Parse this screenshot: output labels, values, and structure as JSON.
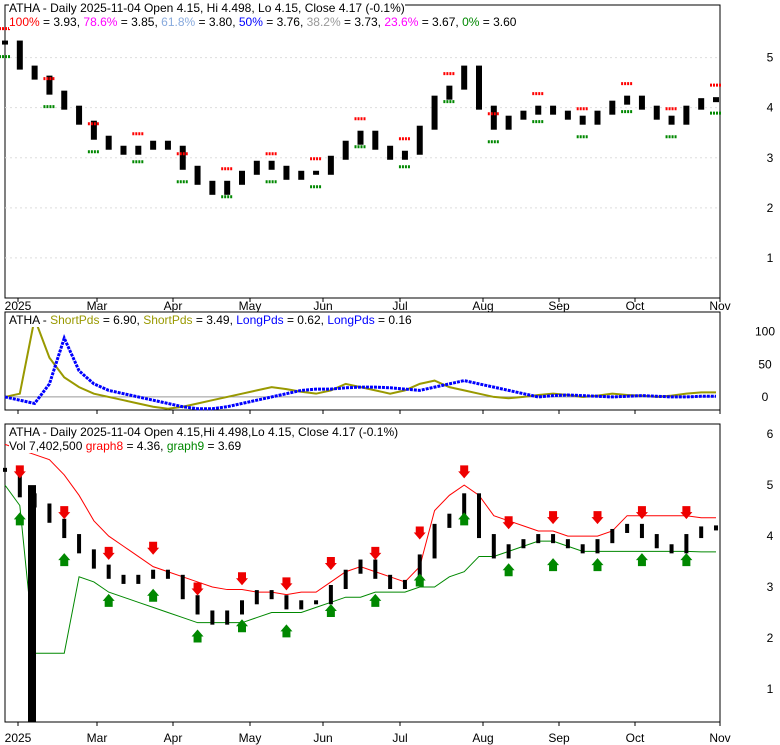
{
  "chart_data": [
    {
      "type": "line",
      "title": "ATHA - Daily 2025-11-04 Open 4.15, Hi 4.498, Lo 4.15, Close 4.17 (-0.1%)",
      "fib": [
        {
          "label": "100%",
          "value": "3.93",
          "color": "#ff0000"
        },
        {
          "label": "78.6%",
          "value": "3.85",
          "color": "#ff00ff"
        },
        {
          "label": "61.8%",
          "value": "3.80",
          "color": "#88aadd"
        },
        {
          "label": "50%",
          "value": "3.76",
          "color": "#0000ff"
        },
        {
          "label": "38.2%",
          "value": "3.73",
          "color": "#999999"
        },
        {
          "label": "23.6%",
          "value": "3.67",
          "color": "#ff00ff"
        },
        {
          "label": "0%",
          "value": "3.60",
          "color": "#008800"
        }
      ],
      "ylim": [
        0.5,
        6.5
      ],
      "yticks": [
        1,
        2,
        3,
        4,
        5
      ],
      "xticks": [
        "2025",
        "Mar",
        "Apr",
        "May",
        "Jun",
        "Jul",
        "Aug",
        "Sep",
        "Oct",
        "Nov"
      ],
      "close": [
        5.3,
        4.8,
        4.6,
        4.3,
        4.0,
        3.7,
        3.4,
        3.2,
        3.1,
        3.2,
        3.3,
        3.2,
        2.8,
        2.5,
        2.3,
        2.5,
        2.7,
        2.9,
        2.8,
        2.6,
        2.7,
        2.7,
        3.0,
        3.3,
        3.5,
        3.2,
        3.0,
        3.1,
        3.6,
        4.2,
        4.4,
        4.8,
        4.0,
        3.6,
        3.8,
        3.9,
        4.0,
        3.9,
        3.8,
        3.7,
        3.9,
        4.1,
        4.2,
        4.0,
        3.8,
        3.7,
        4.0,
        4.15,
        4.17
      ]
    },
    {
      "type": "line",
      "title": "ATHA - ShortPds = 6.90, ShortPds = 3.49, LongPds = 0.62, LongPds = 0.16",
      "legend": [
        {
          "name": "ShortPds",
          "value": "6.90",
          "color": "#999900"
        },
        {
          "name": "ShortPds",
          "value": "3.49",
          "color": "#999900"
        },
        {
          "name": "LongPds",
          "value": "0.62",
          "color": "#0000ff"
        },
        {
          "name": "LongPds",
          "value": "0.16",
          "color": "#0000ff"
        }
      ],
      "yticks": [
        100,
        50,
        0
      ],
      "ylim": [
        -20,
        130
      ],
      "series": [
        {
          "name": "ShortPds",
          "color": "#999900",
          "values": [
            0,
            5,
            120,
            60,
            30,
            15,
            5,
            0,
            -5,
            -10,
            -15,
            -18,
            -15,
            -10,
            -5,
            0,
            5,
            10,
            15,
            12,
            8,
            5,
            10,
            20,
            15,
            10,
            5,
            10,
            20,
            25,
            15,
            10,
            5,
            0,
            -2,
            0,
            3,
            5,
            3,
            0,
            2,
            5,
            3,
            2,
            0,
            2,
            5,
            7,
            7
          ]
        },
        {
          "name": "LongPds",
          "color": "#0000ff",
          "values": [
            0,
            -5,
            -10,
            20,
            90,
            40,
            20,
            10,
            5,
            0,
            -5,
            -10,
            -15,
            -18,
            -18,
            -15,
            -10,
            -5,
            0,
            5,
            10,
            12,
            12,
            14,
            15,
            15,
            14,
            12,
            10,
            15,
            20,
            25,
            20,
            15,
            10,
            5,
            0,
            2,
            3,
            2,
            1,
            0,
            1,
            2,
            1,
            0,
            0,
            1,
            1
          ]
        }
      ]
    },
    {
      "type": "line",
      "title": "ATHA - Daily 2025-11-04 Open 4.15,Hi 4.498,Lo 4.15, Close 4.17 (-0.1%)",
      "legend": [
        {
          "name": "Vol",
          "value": "7,402,500",
          "color": "#000000"
        },
        {
          "name": "graph8",
          "value": "4.36",
          "color": "#ff0000"
        },
        {
          "name": "graph9",
          "value": "3.69",
          "color": "#008800"
        }
      ],
      "ylim": [
        0.5,
        6.5
      ],
      "yticks": [
        1,
        2,
        3,
        4,
        5,
        6
      ],
      "graph8": [
        5.8,
        5.7,
        5.6,
        5.5,
        5.2,
        4.8,
        4.3,
        4.0,
        3.8,
        3.6,
        3.4,
        3.3,
        3.2,
        3.1,
        3.0,
        2.95,
        2.95,
        2.9,
        2.9,
        2.85,
        2.9,
        2.9,
        3.1,
        3.3,
        3.4,
        3.3,
        3.2,
        3.1,
        3.4,
        4.5,
        4.8,
        5.0,
        4.8,
        4.4,
        4.3,
        4.2,
        4.1,
        4.1,
        4.0,
        4.0,
        4.0,
        4.1,
        4.4,
        4.4,
        4.4,
        4.4,
        4.4,
        4.36,
        4.36
      ],
      "graph9": [
        5.0,
        4.6,
        1.7,
        1.7,
        1.7,
        3.2,
        3.1,
        2.9,
        2.8,
        2.7,
        2.6,
        2.5,
        2.4,
        2.3,
        2.3,
        2.3,
        2.3,
        2.4,
        2.5,
        2.5,
        2.5,
        2.6,
        2.7,
        2.8,
        2.8,
        2.9,
        2.9,
        2.9,
        3.0,
        3.0,
        3.2,
        3.3,
        3.6,
        3.6,
        3.7,
        3.8,
        3.9,
        3.9,
        3.8,
        3.7,
        3.7,
        3.7,
        3.7,
        3.7,
        3.7,
        3.7,
        3.7,
        3.69,
        3.69
      ]
    }
  ]
}
